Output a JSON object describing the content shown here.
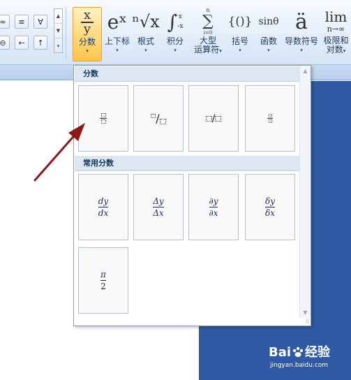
{
  "ribbon": {
    "left_symbols": [
      "≈",
      "≡",
      "∀",
      "⊖",
      "←",
      "↑"
    ],
    "left_scroll": [
      "▲",
      "▼",
      "▾"
    ],
    "tools": [
      {
        "id": "fraction",
        "glyph_top": "x",
        "glyph_bottom": "y",
        "label": "分数",
        "arrow": "▾"
      },
      {
        "id": "script",
        "glyph": "eˣ",
        "label": "上下标",
        "arrow": "▾"
      },
      {
        "id": "radical",
        "glyph": "ⁿ√x",
        "label": "根式",
        "arrow": "▾"
      },
      {
        "id": "integral",
        "glyph": "∫",
        "glyph_sup": "x",
        "glyph_sub": "-x",
        "label": "积分",
        "arrow": "▾"
      },
      {
        "id": "large-operator",
        "glyph": "∑",
        "glyph_sup": "n",
        "glyph_sub": "i=0",
        "label_line1": "大型",
        "label_line2": "运算符",
        "arrow": "▾"
      },
      {
        "id": "bracket",
        "glyph": "{()}",
        "label": "括号",
        "arrow": "▾"
      },
      {
        "id": "function",
        "glyph": "sinθ",
        "label": "函数",
        "arrow": "▾"
      },
      {
        "id": "accent",
        "glyph": "ä",
        "label": "导数符号",
        "arrow": "▾"
      },
      {
        "id": "limit",
        "glyph": "lim",
        "glyph_sub": "n→∞",
        "label_line1": "极限和",
        "label_line2": "对数",
        "arrow": "▾"
      }
    ]
  },
  "gallery": {
    "section1_title": "分数",
    "section2_title": "常用分数",
    "common": [
      {
        "num": "dy",
        "den": "dx"
      },
      {
        "num": "Δy",
        "den": "Δx"
      },
      {
        "num": "∂y",
        "den": "∂x"
      },
      {
        "num": "δy",
        "den": "δx"
      },
      {
        "num": "π",
        "den": "2"
      }
    ],
    "slash": "/",
    "scroll_up": "▲",
    "scroll_down": "▼",
    "grip": "⠿"
  },
  "watermark": {
    "brand_left": "Bai",
    "brand_right": "经验",
    "url": "jingyan.baidu.com"
  },
  "colors": {
    "accent_active": "#ffc34a",
    "doc_blue": "#2f59a3",
    "annotation_arrow": "#8b1a1a"
  }
}
